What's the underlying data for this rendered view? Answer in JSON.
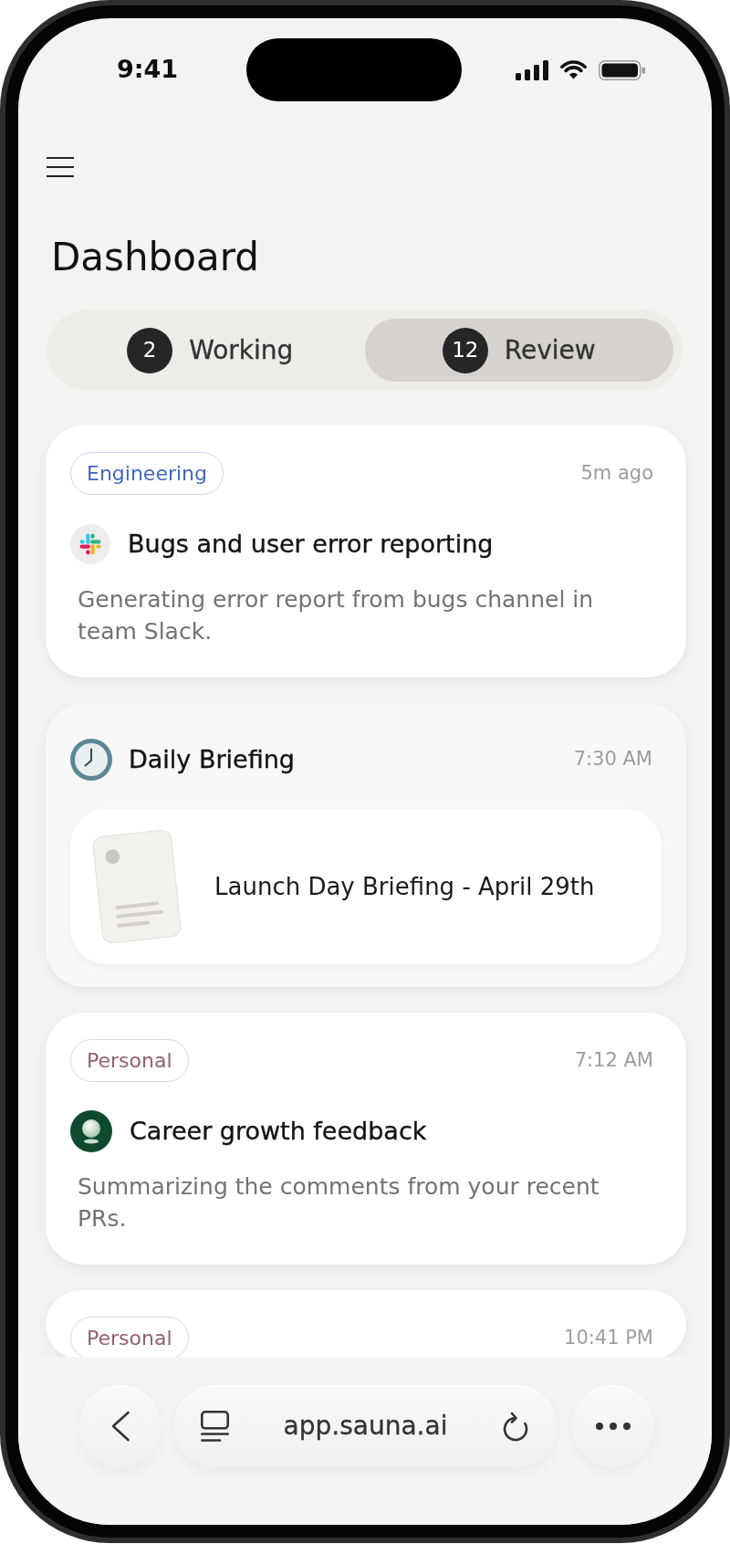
{
  "status_bar": {
    "time": "9:41"
  },
  "header": {
    "title": "Dashboard"
  },
  "tabs": [
    {
      "count": "2",
      "label": "Working",
      "selected": false
    },
    {
      "count": "12",
      "label": "Review",
      "selected": true
    }
  ],
  "cards": [
    {
      "kind": "task",
      "tag": {
        "label": "Engineering",
        "color": "#4466c6"
      },
      "time": "5m ago",
      "title": "Bugs and user error reporting",
      "description": "Generating error report from bugs channel in team Slack."
    },
    {
      "kind": "briefing",
      "title": "Daily Briefing",
      "time": "7:30 AM",
      "attachment": {
        "title": "Launch Day Briefing - April 29th"
      }
    },
    {
      "kind": "task",
      "tag": {
        "label": "Personal",
        "color": "#93606e"
      },
      "time": "7:12 AM",
      "title": "Career growth feedback",
      "description": "Summarizing the comments from your recent PRs."
    },
    {
      "kind": "task",
      "tag": {
        "label": "Personal",
        "color": "#93606e"
      },
      "time": "10:41 PM"
    }
  ],
  "browser_bar": {
    "url": "app.sauna.ai"
  }
}
